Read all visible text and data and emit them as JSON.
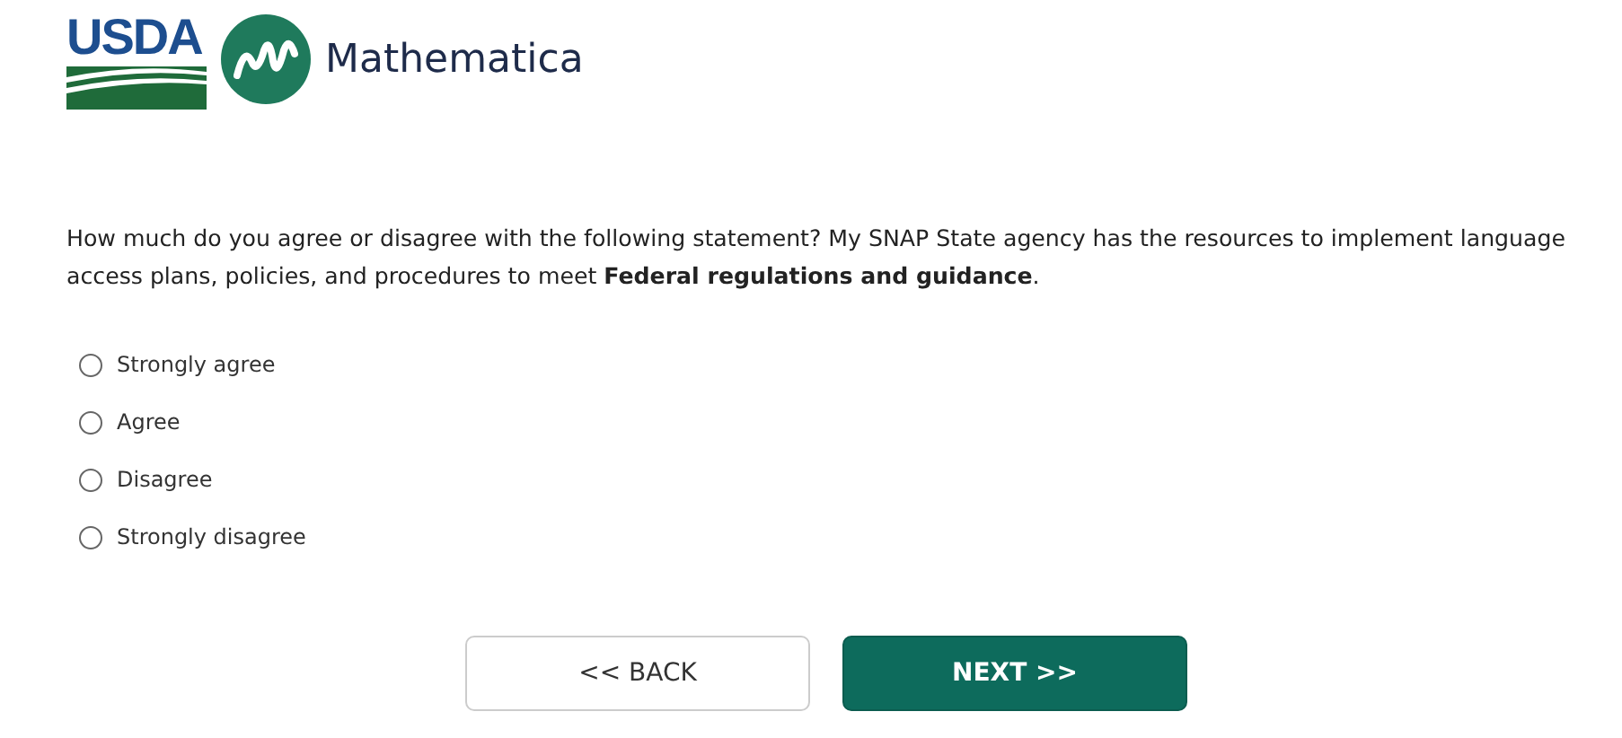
{
  "logos": {
    "usda": "USDA",
    "mathematica": "Mathematica"
  },
  "question": "How much do you agree or disagree with the following statement? My SNAP State agency has the resources to implement language access plans, policies, and procedures to meet **Federal regulations and guidance**.",
  "options": [
    {
      "label": "Strongly agree",
      "selected": false
    },
    {
      "label": "Agree",
      "selected": false
    },
    {
      "label": "Disagree",
      "selected": false
    },
    {
      "label": "Strongly disagree",
      "selected": false
    }
  ],
  "buttons": [
    {
      "label": "<< BACK",
      "kind": "secondary"
    },
    {
      "label": "NEXT >>",
      "kind": "primary"
    }
  ]
}
